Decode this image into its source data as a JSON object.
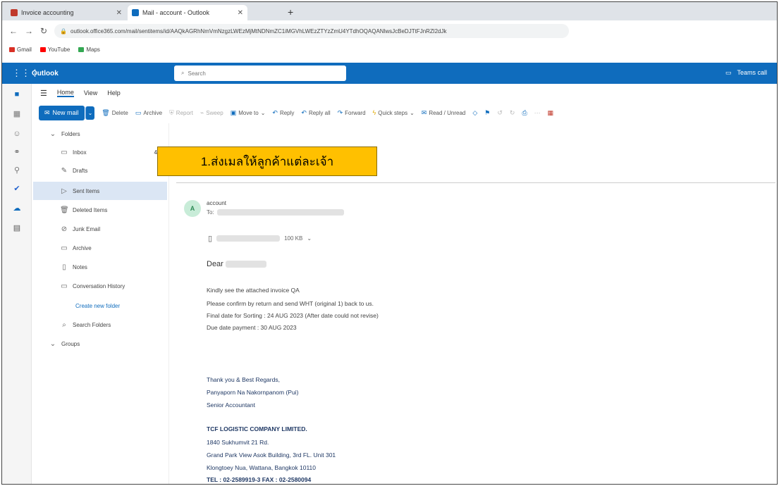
{
  "browser": {
    "tabs": [
      {
        "label": "Invoice accounting",
        "active": false
      },
      {
        "label": "Mail - account - Outlook",
        "active": true
      }
    ],
    "url": "outlook.office365.com/mail/sentitems/id/AAQkAGRhNmVmNzgzLWEzMjMtNDNmZC1iMGVhLWEzZTYzZmU4YTdhOQAQANlwsJcBeDJTtFJnRZl2dJk",
    "bookmarks": [
      "Gmail",
      "YouTube",
      "Maps"
    ]
  },
  "outlook": {
    "app_title": "Outlook",
    "search_placeholder": "Search",
    "account_label": "Teams call",
    "ribbon_tabs": [
      "Home",
      "View",
      "Help"
    ],
    "toolbar": {
      "new_mail": "New mail",
      "items": [
        "Delete",
        "Archive",
        "Report",
        "Sweep",
        "Move to",
        "Reply",
        "Reply all",
        "Forward",
        "Quick steps",
        "Read / Unread"
      ]
    },
    "folders": {
      "header": "Folders",
      "items": [
        {
          "label": "Inbox",
          "count": "4"
        },
        {
          "label": "Drafts",
          "count": ""
        },
        {
          "label": "Sent Items",
          "count": ""
        },
        {
          "label": "Deleted Items",
          "count": ""
        },
        {
          "label": "Junk Email",
          "count": ""
        },
        {
          "label": "Archive",
          "count": ""
        },
        {
          "label": "Notes",
          "count": ""
        },
        {
          "label": "Conversation History",
          "count": ""
        },
        {
          "label": "Create new folder",
          "count": ""
        },
        {
          "label": "Search Folders",
          "count": ""
        }
      ],
      "groups_label": "Groups"
    }
  },
  "message": {
    "avatar_initials": "A",
    "sender": "account",
    "to_prefix": "To:",
    "attachment_size": "100 KB",
    "greeting": "Dear",
    "lines": [
      "Kindly see the attached invoice QA",
      "Please confirm by return and send WHT (original 1) back to us.",
      "Final date for Sorting : 24 AUG 2023 (After date could not revise)",
      "Due date payment : 30 AUG 2023"
    ],
    "signature": {
      "closing": "Thank you & Best Regards,",
      "name": "Panyaporn Na Nakornpanom (Pui)",
      "title": "Senior Accountant",
      "company": "TCF LOGISTIC COMPANY LIMITED.",
      "addr1": "1840 Sukhumvit 21 Rd.",
      "addr2": "Grand Park View Asok Building, 3rd FL. Unit 301",
      "addr3": "Klongtoey Nua, Wattana, Bangkok 10110",
      "tel": "TEL : 02-2589919-3 FAX : 02-2580094"
    }
  },
  "annotation": {
    "text": "1.ส่งเมลให้ลูกค้าแต่ละเจ้า",
    "color": "#ffc000"
  }
}
